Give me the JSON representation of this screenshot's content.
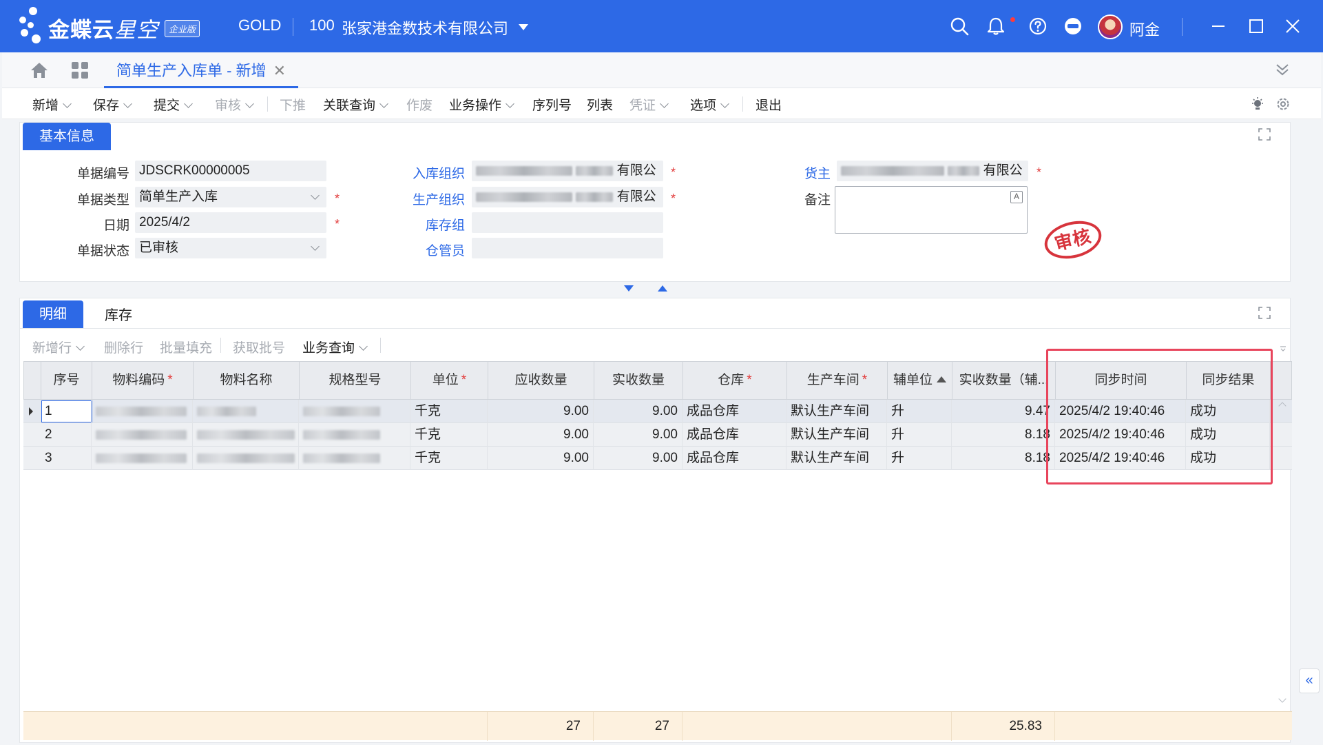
{
  "app": {
    "logo_main": "金蝶云",
    "logo_sub": "星空",
    "edition": "企业版",
    "db_name": "GOLD",
    "org_code": "100",
    "org_name": "张家港金数技术有限公司",
    "user": "阿金"
  },
  "tab": {
    "title": "简单生产入库单 - 新增",
    "close": "✕"
  },
  "toolbar": {
    "new": "新增",
    "save": "保存",
    "submit": "提交",
    "audit": "审核",
    "push": "下推",
    "related_query": "关联查询",
    "void": "作废",
    "business_ops": "业务操作",
    "serial_no": "序列号",
    "list": "列表",
    "voucher": "凭证",
    "options": "选项",
    "exit": "退出"
  },
  "basic_info": {
    "tab_label": "基本信息",
    "bill_no_label": "单据编号",
    "bill_no": "JDSCRK00000005",
    "bill_type_label": "单据类型",
    "bill_type": "简单生产入库",
    "date_label": "日期",
    "date": "2025/4/2",
    "status_label": "单据状态",
    "status": "已审核",
    "stock_org_label": "入库组织",
    "stock_org_suffix": "有限公",
    "prd_org_label": "生产组织",
    "prd_org_suffix": "有限公",
    "stock_group_label": "库存组",
    "stocker_label": "仓管员",
    "owner_label": "货主",
    "owner_suffix": "有限公",
    "remark_label": "备注",
    "required_mark": "*",
    "stamp": "审核"
  },
  "detail": {
    "tab_detail": "明细",
    "tab_stock": "库存",
    "tools": {
      "add_row": "新增行",
      "delete_row": "删除行",
      "batch_fill": "批量填充",
      "get_lot": "获取批号",
      "biz_query": "业务查询"
    },
    "columns": {
      "seq": "序号",
      "material_code": "物料编码",
      "material_name": "物料名称",
      "spec": "规格型号",
      "unit": "单位",
      "must_qty": "应收数量",
      "real_qty": "实收数量",
      "stock": "仓库",
      "workshop": "生产车间",
      "aux_unit": "辅单位",
      "aux_qty": "实收数量（辅...",
      "sync_time": "同步时间",
      "sync_result": "同步结果"
    },
    "rows": [
      {
        "seq": "1",
        "unit": "千克",
        "must_qty": "9.00",
        "real_qty": "9.00",
        "stock": "成品仓库",
        "workshop": "默认生产车间",
        "aux_unit": "升",
        "aux_qty": "9.47",
        "sync_time": "2025/4/2 19:40:46",
        "sync_result": "成功"
      },
      {
        "seq": "2",
        "unit": "千克",
        "must_qty": "9.00",
        "real_qty": "9.00",
        "stock": "成品仓库",
        "workshop": "默认生产车间",
        "aux_unit": "升",
        "aux_qty": "8.18",
        "sync_time": "2025/4/2 19:40:46",
        "sync_result": "成功"
      },
      {
        "seq": "3",
        "unit": "千克",
        "must_qty": "9.00",
        "real_qty": "9.00",
        "stock": "成品仓库",
        "workshop": "默认生产车间",
        "aux_unit": "升",
        "aux_qty": "8.18",
        "sync_time": "2025/4/2 19:40:46",
        "sync_result": "成功"
      }
    ],
    "totals": {
      "must_qty": "27",
      "real_qty": "27",
      "aux_qty": "25.83"
    }
  },
  "colors": {
    "brand": "#2d69e6",
    "required": "#e23b3b",
    "highlight": "#e8455c",
    "footer_bg": "#fdf1df"
  }
}
